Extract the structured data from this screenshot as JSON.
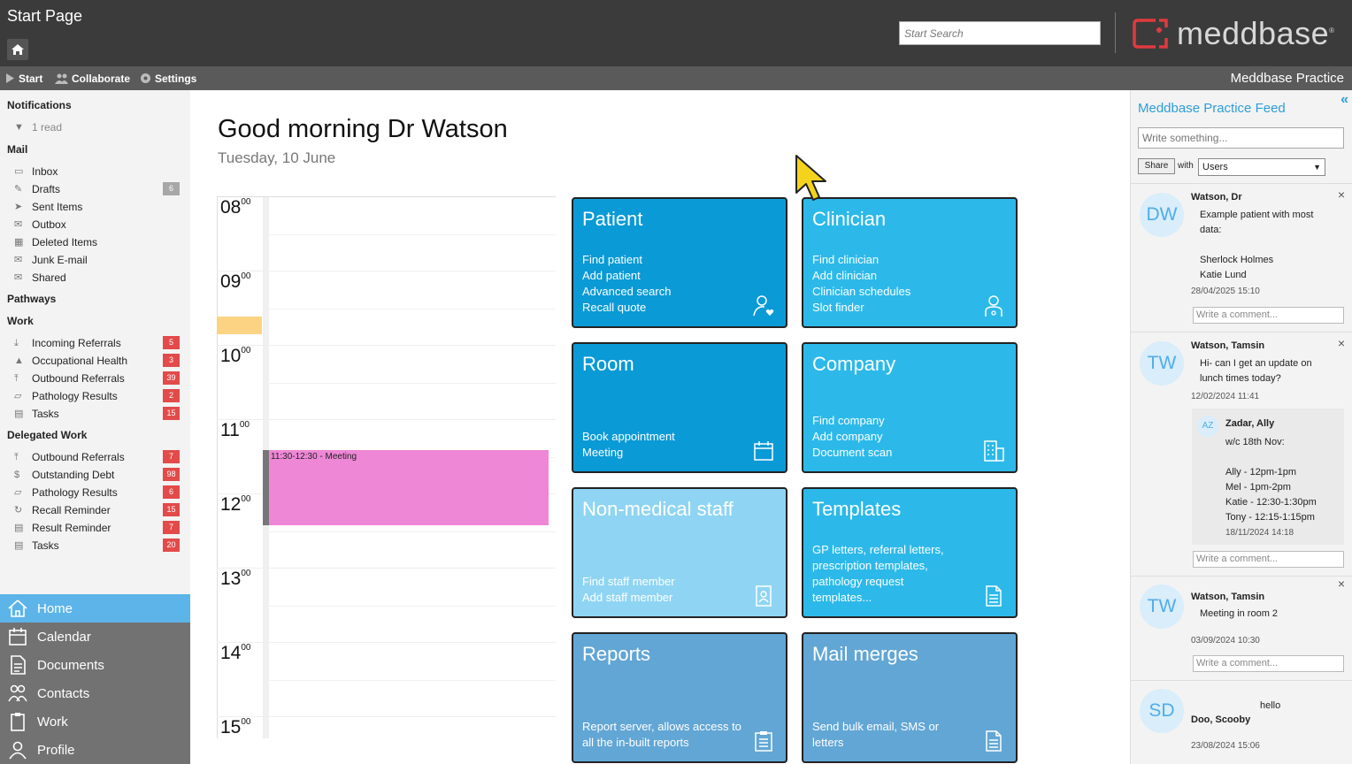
{
  "window": {
    "title": "Start Page"
  },
  "search": {
    "placeholder": "Start Search"
  },
  "brand": {
    "logo_text": "meddbase",
    "trademark": "®",
    "accent": "#e03a3e",
    "product": "Meddbase Practice"
  },
  "menubar": {
    "start": "Start",
    "collaborate": "Collaborate",
    "settings": "Settings"
  },
  "sidebar": {
    "notifications": {
      "heading": "Notifications",
      "items": [
        {
          "label": "1 read"
        }
      ]
    },
    "mail": {
      "heading": "Mail",
      "items": [
        {
          "label": "Inbox",
          "icon": "inbox-icon"
        },
        {
          "label": "Drafts",
          "icon": "drafts-icon",
          "badge": "6"
        },
        {
          "label": "Sent Items",
          "icon": "sent-icon"
        },
        {
          "label": "Outbox",
          "icon": "outbox-icon"
        },
        {
          "label": "Deleted Items",
          "icon": "trash-icon"
        },
        {
          "label": "Junk E-mail",
          "icon": "junk-icon"
        },
        {
          "label": "Shared",
          "icon": "shared-icon"
        }
      ]
    },
    "pathways": {
      "heading": "Pathways"
    },
    "work": {
      "heading": "Work",
      "items": [
        {
          "label": "Incoming Referrals",
          "badge": "5"
        },
        {
          "label": "Occupational Health",
          "badge": "3"
        },
        {
          "label": "Outbound Referrals",
          "badge": "39"
        },
        {
          "label": "Pathology Results",
          "badge": "2"
        },
        {
          "label": "Tasks",
          "badge": "15"
        }
      ]
    },
    "delegated": {
      "heading": "Delegated Work",
      "items": [
        {
          "label": "Outbound Referrals",
          "badge": "7"
        },
        {
          "label": "Outstanding Debt",
          "badge": "98"
        },
        {
          "label": "Pathology Results",
          "badge": "6"
        },
        {
          "label": "Recall Reminder",
          "badge": "15"
        },
        {
          "label": "Result Reminder",
          "badge": "7"
        },
        {
          "label": "Tasks",
          "badge": "20"
        }
      ]
    },
    "nav": [
      {
        "label": "Home",
        "icon": "home-icon",
        "active": true
      },
      {
        "label": "Calendar",
        "icon": "calendar-icon"
      },
      {
        "label": "Documents",
        "icon": "documents-icon"
      },
      {
        "label": "Contacts",
        "icon": "contacts-icon"
      },
      {
        "label": "Work",
        "icon": "work-icon"
      },
      {
        "label": "Profile",
        "icon": "profile-icon"
      }
    ]
  },
  "main": {
    "greeting": "Good morning Dr Watson",
    "date": "Tuesday, 10 June",
    "calendar": {
      "hours": [
        {
          "h": "08",
          "m": "00"
        },
        {
          "h": "09",
          "m": "00"
        },
        {
          "h": "10",
          "m": "00"
        },
        {
          "h": "11",
          "m": "00"
        },
        {
          "h": "12",
          "m": "00"
        },
        {
          "h": "13",
          "m": "00"
        },
        {
          "h": "14",
          "m": "00"
        },
        {
          "h": "15",
          "m": "00"
        }
      ],
      "event": {
        "label": "11:30-12:30 - Meeting",
        "color": "#ef87d7"
      },
      "free_slot_color": "#fcd382"
    },
    "tiles": [
      {
        "title": "Patient",
        "links": [
          "Find patient",
          "Add patient",
          "Advanced search",
          "Recall quote"
        ],
        "color": "#0a9ad6",
        "icon": "patient-icon"
      },
      {
        "title": "Clinician",
        "links": [
          "Find clinician",
          "Add clinician",
          "Clinician schedules",
          "Slot finder"
        ],
        "color": "#2cb9ea",
        "icon": "clinician-icon"
      },
      {
        "title": "Room",
        "links": [
          "Book appointment",
          "Meeting"
        ],
        "color": "#0a9ad6",
        "icon": "calendar-icon"
      },
      {
        "title": "Company",
        "links": [
          "Find company",
          "Add company",
          "Document scan"
        ],
        "color": "#2cb9ea",
        "icon": "building-icon"
      },
      {
        "title": "Non-medical staff",
        "links": [
          "Find staff member",
          "Add staff member"
        ],
        "color": "#8fd5f3",
        "icon": "badge-icon"
      },
      {
        "title": "Templates",
        "links": [
          "GP letters, referral letters,",
          "prescription templates,",
          "pathology request",
          "templates..."
        ],
        "color": "#2cb9ea",
        "icon": "document-icon"
      },
      {
        "title": "Reports",
        "links": [
          "Report server, allows access to",
          "all the in-built reports"
        ],
        "color": "#62a6d5",
        "icon": "clipboard-icon"
      },
      {
        "title": "Mail merges",
        "links": [
          "Send bulk email, SMS or",
          "letters"
        ],
        "color": "#62a6d5",
        "icon": "document-icon"
      }
    ]
  },
  "feed": {
    "title": "Meddbase Practice Feed",
    "input_placeholder": "Write something...",
    "share_label": "Share",
    "with_label": "with",
    "share_with_value": "Users",
    "comment_placeholder": "Write a comment...",
    "posts": [
      {
        "initials": "DW",
        "author": "Watson, Dr",
        "text": "Example patient with most\ndata:\n\nSherlock Holmes\nKatie Lund",
        "date": "28/04/2025 15:10"
      },
      {
        "initials": "TW",
        "author": "Watson, Tamsin",
        "text": "Hi- can I get an update on\nlunch times today?",
        "date": "12/02/2024 11:41",
        "reply": {
          "initials": "AZ",
          "author": "Zadar, Ally",
          "text": "w/c 18th Nov:\n\nAlly - 12pm-1pm\nMel - 1pm-2pm\nKatie - 12:30-1:30pm\nTony - 12:15-1:15pm",
          "date": "18/11/2024 14:18"
        }
      },
      {
        "initials": "TW",
        "author": "Watson, Tamsin",
        "text": "Meeting in room 2",
        "date": "03/09/2024 10:30"
      },
      {
        "initials": "SD",
        "author": "Doo, Scooby",
        "text": "hello",
        "date": "23/08/2024 15:06"
      }
    ]
  }
}
